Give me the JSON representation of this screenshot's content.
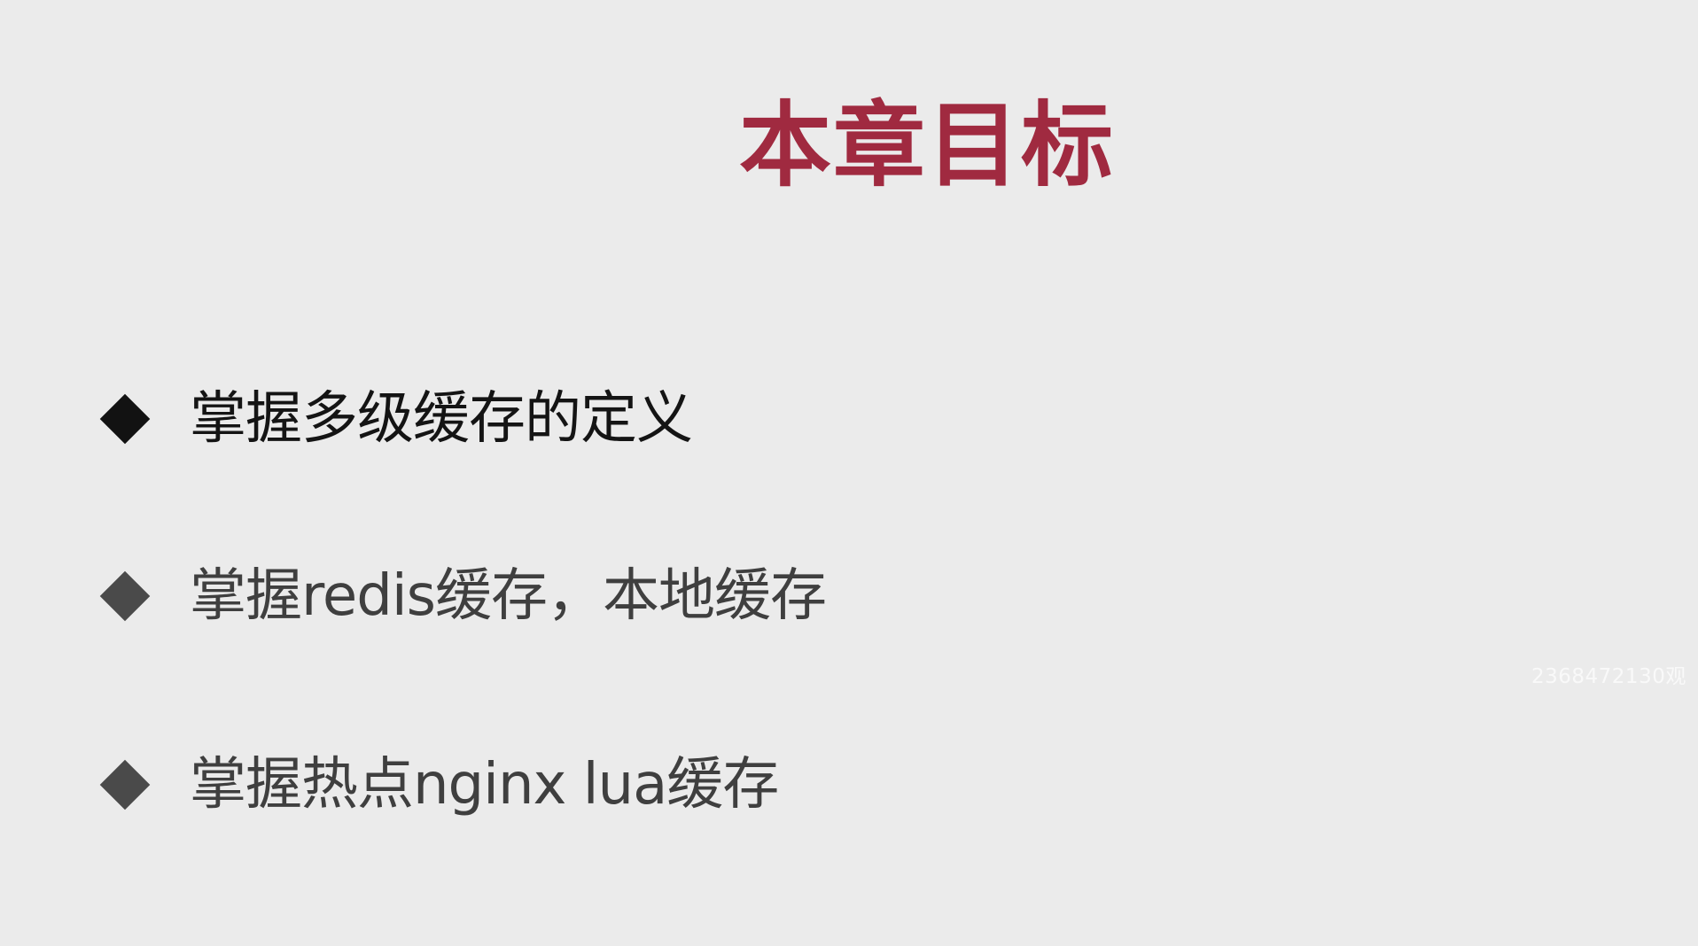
{
  "slide": {
    "title": "本章目标",
    "bullets": [
      {
        "text": "掌握多级缓存的定义",
        "icon": "diamond-bullet-icon"
      },
      {
        "text": "掌握redis缓存，本地缓存",
        "icon": "diamond-bullet-icon"
      },
      {
        "text": "掌握热点nginx lua缓存",
        "icon": "diamond-bullet-icon"
      }
    ],
    "watermark": "2368472130观"
  },
  "colors": {
    "background": "#ebebeb",
    "title": "#a02a40",
    "bullet_dark": "#141414",
    "bullet_grey": "#3f3f3f",
    "watermark": "#fafafa"
  }
}
